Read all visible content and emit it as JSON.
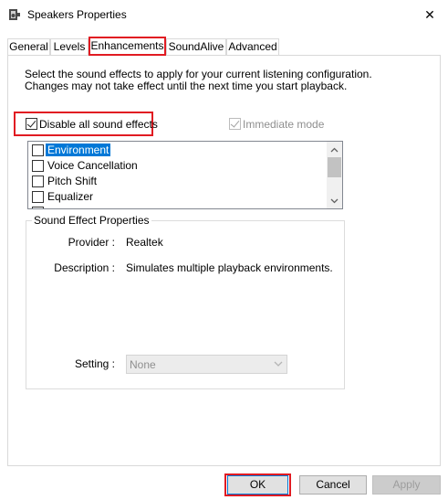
{
  "window": {
    "title": "Speakers Properties",
    "close_symbol": "✕",
    "title_icon": "speaker-icon",
    "highlight_color": "#e11b22",
    "selection_color": "#0078d7"
  },
  "tabs": [
    {
      "label": "General",
      "active": false
    },
    {
      "label": "Levels",
      "active": false
    },
    {
      "label": "Enhancements",
      "active": true
    },
    {
      "label": "SoundAlive",
      "active": false
    },
    {
      "label": "Advanced",
      "active": false
    }
  ],
  "enhancements": {
    "description": "Select the sound effects to apply for your current listening configuration. Changes may not take effect until the next time you start playback.",
    "disable_all": {
      "label": "Disable all sound effects",
      "checked": true
    },
    "immediate_mode": {
      "label": "Immediate mode",
      "checked": true,
      "enabled": false
    },
    "effects": [
      {
        "label": "Environment",
        "checked": false,
        "selected": true
      },
      {
        "label": "Voice Cancellation",
        "checked": false,
        "selected": false
      },
      {
        "label": "Pitch Shift",
        "checked": false,
        "selected": false
      },
      {
        "label": "Equalizer",
        "checked": false,
        "selected": false
      }
    ],
    "properties": {
      "group_title": "Sound Effect Properties",
      "provider_label": "Provider :",
      "provider_value": "Realtek",
      "description_label": "Description :",
      "description_value": "Simulates multiple playback environments.",
      "setting_label": "Setting :",
      "setting_value": "None"
    }
  },
  "buttons": {
    "ok": "OK",
    "cancel": "Cancel",
    "apply": "Apply"
  }
}
